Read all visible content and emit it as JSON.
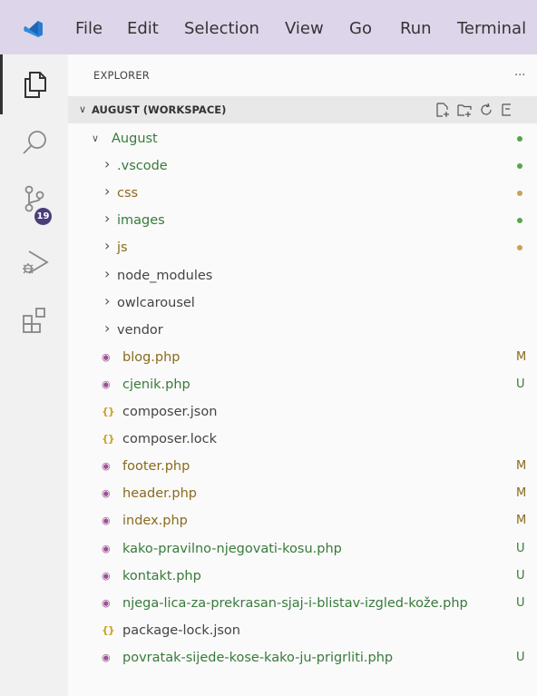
{
  "menubar": {
    "items": [
      "File",
      "Edit",
      "Selection",
      "View",
      "Go",
      "Run",
      "Terminal"
    ]
  },
  "activity_bar": {
    "icons": [
      "explorer-icon",
      "search-icon",
      "source-control-icon",
      "run-debug-icon",
      "extensions-icon"
    ],
    "scm_badge": "19"
  },
  "explorer": {
    "title": "EXPLORER",
    "more": "···",
    "workspace": "AUGUST (WORKSPACE)",
    "rows": [
      {
        "label": "August",
        "type": "folder",
        "indent": 1,
        "color": "green",
        "status": "dot-green"
      },
      {
        "label": ".vscode",
        "type": "folder",
        "indent": 2,
        "color": "green",
        "status": "dot-green"
      },
      {
        "label": "css",
        "type": "folder",
        "indent": 2,
        "color": "brown",
        "status": "dot-brown"
      },
      {
        "label": "images",
        "type": "folder",
        "indent": 2,
        "color": "green",
        "status": "dot-green"
      },
      {
        "label": "js",
        "type": "folder",
        "indent": 2,
        "color": "brown",
        "status": "dot-brown"
      },
      {
        "label": "node_modules",
        "type": "folder",
        "indent": 2,
        "color": "",
        "status": ""
      },
      {
        "label": "owlcarousel",
        "type": "folder",
        "indent": 2,
        "color": "",
        "status": ""
      },
      {
        "label": "vendor",
        "type": "folder",
        "indent": 2,
        "color": "",
        "status": ""
      },
      {
        "label": "blog.php",
        "type": "php",
        "indent": 2,
        "color": "brown",
        "status": "M"
      },
      {
        "label": "cjenik.php",
        "type": "php",
        "indent": 2,
        "color": "green",
        "status": "U"
      },
      {
        "label": "composer.json",
        "type": "json",
        "indent": 2,
        "color": "",
        "status": ""
      },
      {
        "label": "composer.lock",
        "type": "json",
        "indent": 2,
        "color": "",
        "status": ""
      },
      {
        "label": "footer.php",
        "type": "php",
        "indent": 2,
        "color": "brown",
        "status": "M"
      },
      {
        "label": "header.php",
        "type": "php",
        "indent": 2,
        "color": "brown",
        "status": "M"
      },
      {
        "label": "index.php",
        "type": "php",
        "indent": 2,
        "color": "brown",
        "status": "M"
      },
      {
        "label": "kako-pravilno-njegovati-kosu.php",
        "type": "php",
        "indent": 2,
        "color": "green",
        "status": "U"
      },
      {
        "label": "kontakt.php",
        "type": "php",
        "indent": 2,
        "color": "green",
        "status": "U"
      },
      {
        "label": "njega-lica-za-prekrasan-sjaj-i-blistav-izgled-kože.php",
        "type": "php",
        "indent": 2,
        "color": "green",
        "status": "U"
      },
      {
        "label": "package-lock.json",
        "type": "json",
        "indent": 2,
        "color": "",
        "status": ""
      },
      {
        "label": "povratak-sijede-kose-kako-ju-prigrliti.php",
        "type": "php",
        "indent": 2,
        "color": "green",
        "status": "U"
      }
    ]
  },
  "colors": {
    "menubar_bg": "#ddd6ea",
    "modified": "#8a6a1c",
    "untracked": "#387a3a",
    "dot_green": "#57a64a",
    "dot_brown": "#c7a25a",
    "badge": "#4a3e7a"
  }
}
